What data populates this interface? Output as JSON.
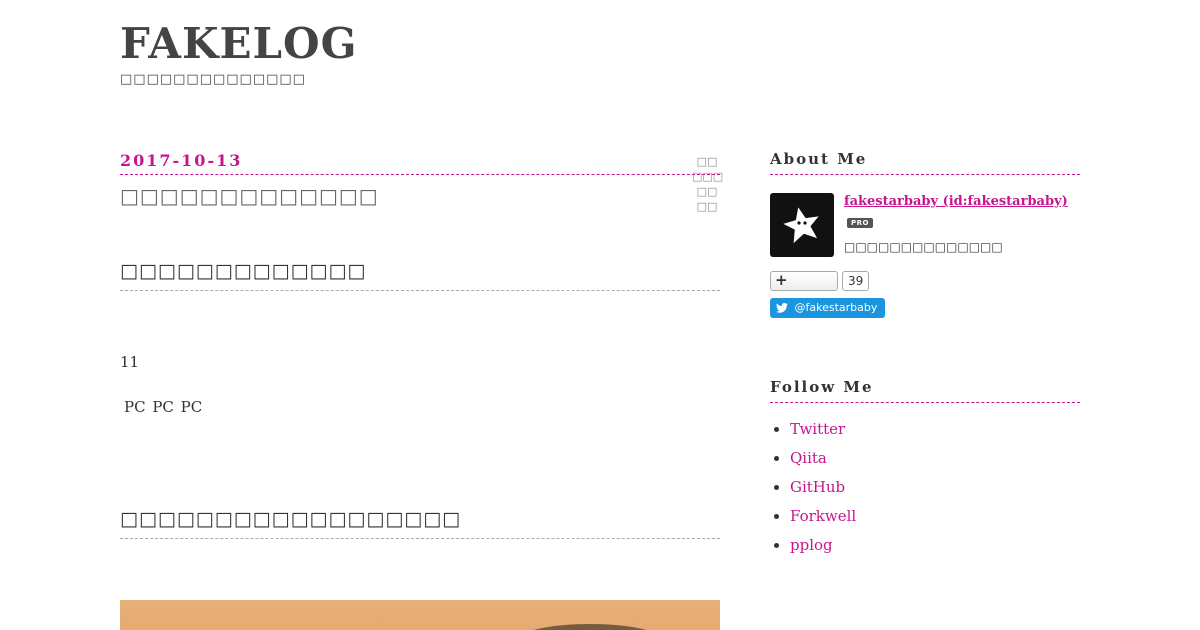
{
  "header": {
    "title": "FAKELOG",
    "description": "□□□□□□□□□□□□□□"
  },
  "entry": {
    "date": "2017-10-13",
    "title": "□□□□□□□□□□□□□",
    "share_items": [
      "□□",
      "□□□",
      "□□",
      "□□"
    ],
    "sections": [
      {
        "heading": "□□□□□□□□□□□□□"
      },
      {
        "heading": "□□□□□□□□□□□□□□□□□□"
      }
    ],
    "paragraphs": [
      "11",
      "PC  PC PC"
    ]
  },
  "sidebar": {
    "about": {
      "title": "About Me",
      "name": "fakestarbaby (id:fakestarbaby)",
      "badge": "PRO",
      "description": "□□□□□□□□□□□□□□",
      "follow_plus": "+",
      "follow_count": "39",
      "twitter_handle": "@fakestarbaby"
    },
    "follow_me": {
      "title": "Follow Me",
      "links": [
        "Twitter",
        "Qiita",
        "GitHub",
        "Forkwell",
        "pplog"
      ]
    }
  },
  "colors": {
    "accent": "#c6168d",
    "twitter": "#1b95e0",
    "text": "#333333"
  }
}
